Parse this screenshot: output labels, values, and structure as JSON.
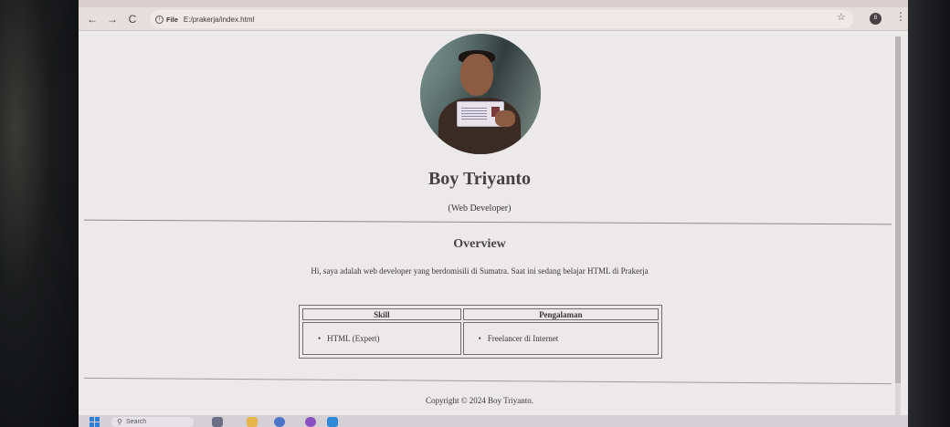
{
  "browser": {
    "back_label": "←",
    "forward_label": "→",
    "reload_label": "C",
    "info_icon": "i",
    "file_chip": "File",
    "url": "E:/prakerja/index.html",
    "star": "☆",
    "profile_initial": "B",
    "menu": "⋮"
  },
  "profile": {
    "name": "Boy Triyanto",
    "role": "(Web Developer)"
  },
  "overview": {
    "title": "Overview",
    "text": "Hi, saya adalah web developer yang berdomisili di Sumatra. Saat ini sedang belajar HTML di Prakerja"
  },
  "table": {
    "headers": [
      "Skill",
      "Pengalaman"
    ],
    "rows": [
      [
        "HTML (Expert)",
        "Freelancer di Internet"
      ]
    ]
  },
  "footer": {
    "copyright": "Copyright © 2024 Boy Triyanto."
  },
  "taskbar": {
    "search_label": "Search",
    "search_icon": "⚲"
  }
}
